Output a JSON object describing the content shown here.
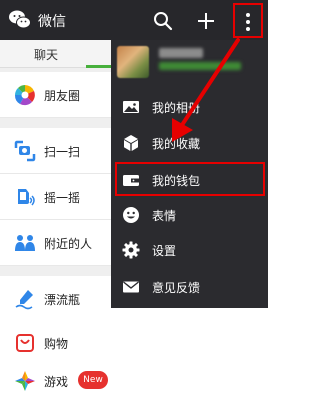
{
  "titlebar": {
    "title": "微信",
    "icons": [
      "wechat-logo-icon",
      "search-icon",
      "plus-icon",
      "more-vertical-icon"
    ]
  },
  "tabs": {
    "chat": "聊天"
  },
  "discover_list": [
    {
      "label": "朋友圈",
      "icon": "moments-icon"
    },
    {
      "label": "扫一扫",
      "icon": "scan-icon"
    },
    {
      "label": "摇一摇",
      "icon": "shake-icon"
    },
    {
      "label": "附近的人",
      "icon": "people-nearby-icon"
    },
    {
      "label": "漂流瓶",
      "icon": "drift-bottle-icon"
    },
    {
      "label": "购物",
      "icon": "shopping-icon"
    },
    {
      "label": "游戏",
      "icon": "games-icon",
      "badge": "New"
    }
  ],
  "menu": {
    "profile": {
      "avatar": "avatar-icon"
    },
    "items": [
      {
        "label": "我的相册",
        "icon": "photo-album-icon"
      },
      {
        "label": "我的收藏",
        "icon": "favorites-icon"
      },
      {
        "label": "我的钱包",
        "icon": "wallet-icon"
      },
      {
        "label": "表情",
        "icon": "sticker-icon"
      },
      {
        "label": "设置",
        "icon": "settings-icon"
      },
      {
        "label": "意见反馈",
        "icon": "feedback-icon"
      }
    ]
  },
  "colors": {
    "titlebar_bg": "#27272b",
    "menu_bg": "#2b2b2f",
    "accent_green": "#47b03c",
    "highlight_red": "#e60000"
  }
}
